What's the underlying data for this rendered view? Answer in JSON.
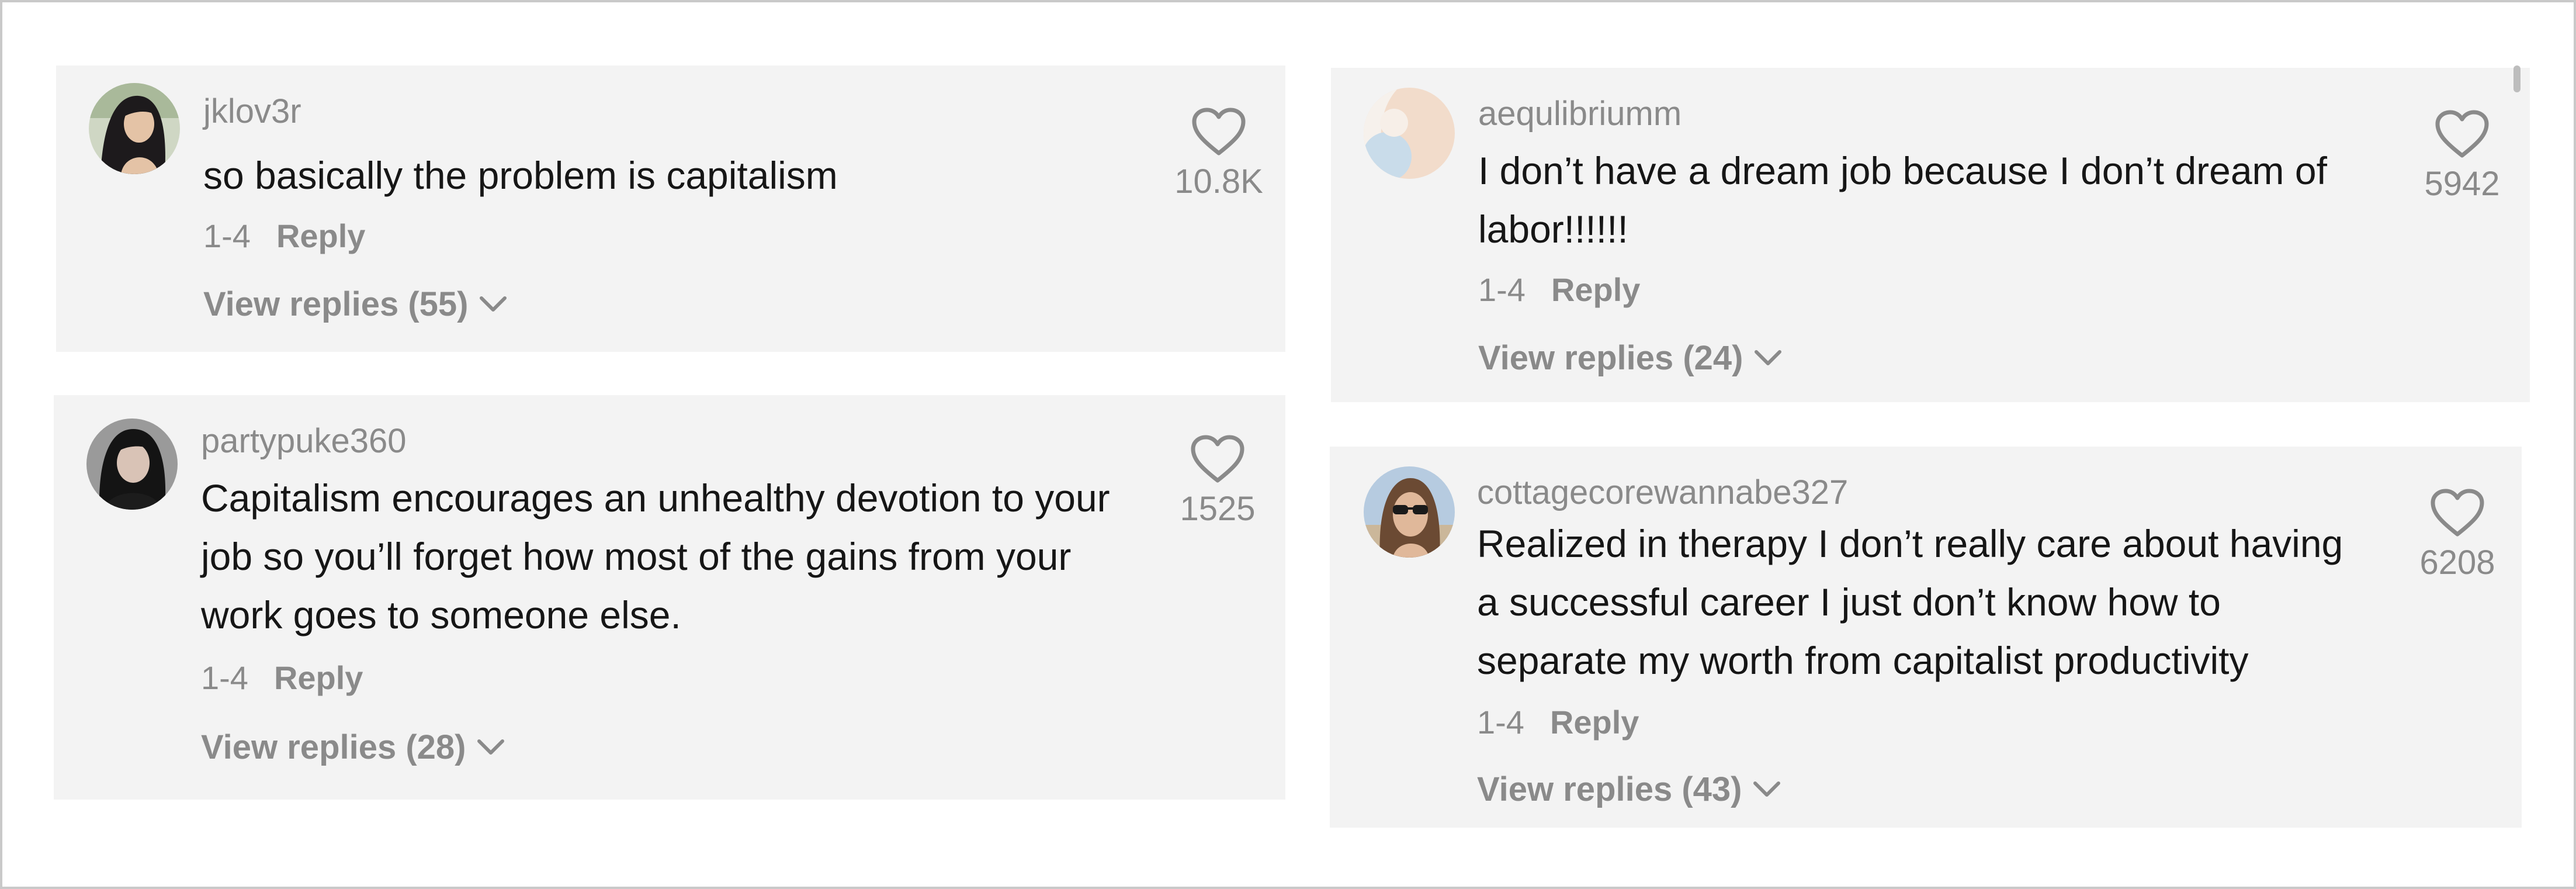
{
  "comments": [
    {
      "username": "jklov3r",
      "text": "so basically the problem is capitalism",
      "date": "1-4",
      "reply_label": "Reply",
      "view_replies": "View replies (55)",
      "likes": "10.8K"
    },
    {
      "username": "partypuke360",
      "text": "Capitalism encourages an unhealthy devotion to your job so you’ll forget how most of the gains from your work goes to someone else.",
      "date": "1-4",
      "reply_label": "Reply",
      "view_replies": "View replies (28)",
      "likes": "1525"
    },
    {
      "username": "aequlibriumm",
      "text": "I don’t have a dream job because I don’t dream of labor!!!!!!",
      "date": "1-4",
      "reply_label": "Reply",
      "view_replies": "View replies (24)",
      "likes": "5942"
    },
    {
      "username": "cottagecorewannabe327",
      "text": "Realized in therapy I don’t really care about having a successful career I just don’t know how to separate my worth from capitalist productivity",
      "date": "1-4",
      "reply_label": "Reply",
      "view_replies": "View replies (43)",
      "likes": "6208"
    }
  ],
  "icons": {
    "like": "heart-outline-icon",
    "expand": "chevron-down-icon"
  },
  "colors": {
    "card_background": "#f3f3f3",
    "muted_text": "#8a8a8a",
    "body_text": "#161616",
    "frame_border": "#c9c9c9"
  }
}
